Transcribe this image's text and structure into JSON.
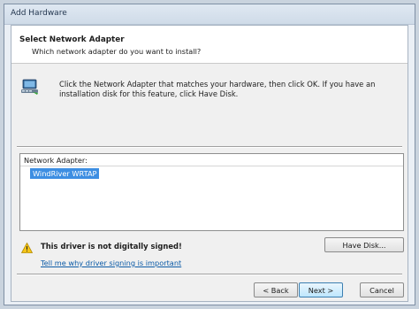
{
  "window": {
    "title": "Add Hardware"
  },
  "header": {
    "title": "Select Network Adapter",
    "subtitle": "Which network adapter do you want to install?"
  },
  "instruction": {
    "text": "Click the Network Adapter that matches your hardware, then click OK. If you have an installation disk for this feature, click Have Disk.",
    "icon": "network-adapter-icon"
  },
  "list": {
    "header": "Network Adapter:",
    "items": [
      {
        "label": "WindRiver WRTAP",
        "selected": true
      }
    ]
  },
  "warning": {
    "icon": "warning-icon",
    "text": "This driver is not digitally signed!",
    "link": "Tell me why driver signing is important"
  },
  "buttons": {
    "have_disk": "Have Disk...",
    "back": "< Back",
    "next": "Next >",
    "cancel": "Cancel"
  },
  "colors": {
    "selection": "#3d8ee2",
    "link": "#0b5aa6"
  }
}
